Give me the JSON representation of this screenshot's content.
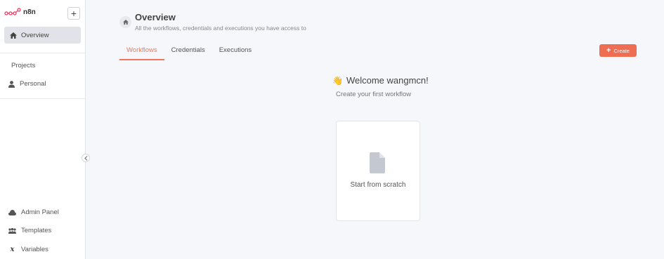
{
  "sidebar": {
    "brand": "n8n",
    "nav_overview": "Overview",
    "projects_title": "Projects",
    "personal": "Personal",
    "bottom_items": [
      {
        "label": "Admin Panel",
        "icon": "cloud-icon"
      },
      {
        "label": "Templates",
        "icon": "templates-icon"
      },
      {
        "label": "Variables",
        "icon": "variables-icon"
      }
    ]
  },
  "header": {
    "title": "Overview",
    "subtitle": "All the workflows, credentials and executions you have access to"
  },
  "tabs": [
    {
      "label": "Workflows",
      "active": true
    },
    {
      "label": "Credentials",
      "active": false
    },
    {
      "label": "Executions",
      "active": false
    }
  ],
  "create_button": "Create",
  "main": {
    "welcome_emoji": "👋",
    "welcome": "Welcome wangmcn!",
    "subtitle": "Create your first workflow",
    "card_label": "Start from scratch"
  },
  "colors": {
    "accent": "#ef6d53",
    "sidebar_active_bg": "#e1e3e8",
    "background": "#f6f7fb"
  }
}
